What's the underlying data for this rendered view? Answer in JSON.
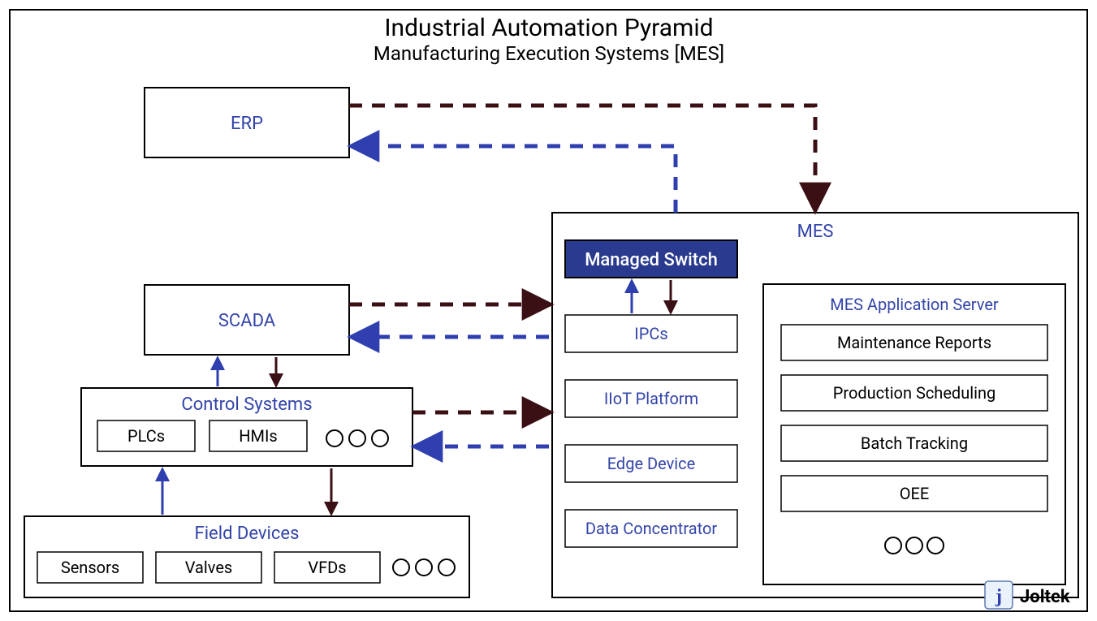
{
  "title": "Industrial Automation Pyramid",
  "subtitle": "Manufacturing Execution Systems [MES]",
  "erp": "ERP",
  "scada": "SCADA",
  "control_systems": {
    "title": "Control Systems",
    "items": [
      "PLCs",
      "HMIs"
    ]
  },
  "field_devices": {
    "title": "Field Devices",
    "items": [
      "Sensors",
      "Valves",
      "VFDs"
    ]
  },
  "mes": {
    "title": "MES",
    "managed_switch": "Managed Switch",
    "left_items": [
      "IPCs",
      "IIoT Platform",
      "Edge Device",
      "Data Concentrator"
    ],
    "app_server": {
      "title": "MES Application Server",
      "items": [
        "Maintenance Reports",
        "Production Scheduling",
        "Batch Tracking",
        "OEE"
      ]
    }
  },
  "brand": "Joltek",
  "colors": {
    "blue": "#2f3fb0",
    "dark": "#3a1015"
  }
}
